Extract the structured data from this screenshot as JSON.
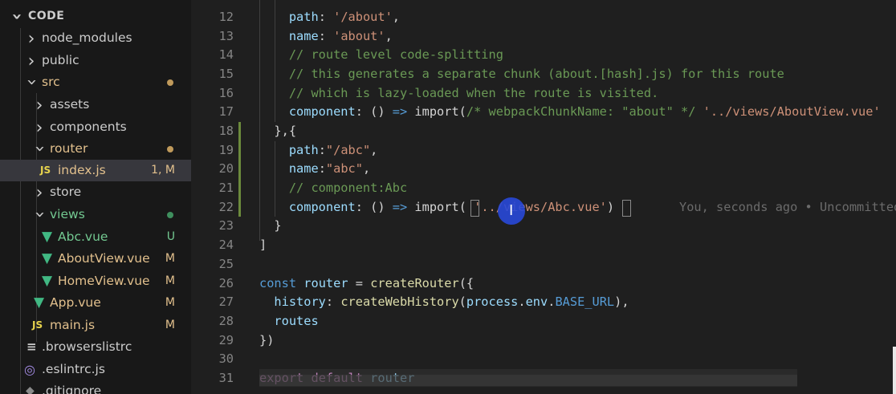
{
  "explorer": {
    "root_label": "CODE",
    "items": [
      {
        "label": "node_modules"
      },
      {
        "label": "public"
      },
      {
        "label": "src"
      },
      {
        "label": "assets"
      },
      {
        "label": "components"
      },
      {
        "label": "router"
      },
      {
        "label": "index.js",
        "icon": "JS",
        "badge": "1, M"
      },
      {
        "label": "store"
      },
      {
        "label": "views"
      },
      {
        "label": "Abc.vue",
        "badge": "U"
      },
      {
        "label": "AboutView.vue",
        "badge": "M"
      },
      {
        "label": "HomeView.vue",
        "badge": "M"
      },
      {
        "label": "App.vue",
        "badge": "M"
      },
      {
        "label": "main.js",
        "icon": "JS",
        "badge": "M"
      },
      {
        "label": ".browserslistrc"
      },
      {
        "label": ".eslintrc.js"
      },
      {
        "label": ".gitignore"
      }
    ]
  },
  "editor": {
    "line_numbers": [
      "12",
      "13",
      "14",
      "15",
      "16",
      "17",
      "18",
      "19",
      "20",
      "21",
      "22",
      "23",
      "24",
      "25",
      "26",
      "27",
      "28",
      "29",
      "30",
      "31"
    ],
    "lines": {
      "l12_a": "    path",
      "l12_b": ": ",
      "l12_c": "'/about'",
      "l12_d": ",",
      "l13_a": "    name",
      "l13_b": ": ",
      "l13_c": "'about'",
      "l13_d": ",",
      "l14": "    // route level code-splitting",
      "l15": "    // this generates a separate chunk (about.[hash].js) for this route",
      "l16": "    // which is lazy-loaded when the route is visited.",
      "l17_a": "    component",
      "l17_b": ": () ",
      "l17_c": "=>",
      "l17_d": " import(",
      "l17_e": "/* webpackChunkName: \"about\" */",
      "l17_f": " ",
      "l17_g": "'../views/AboutView.vue'",
      "l18": "  },{",
      "l19_a": "    path",
      "l19_b": ":",
      "l19_c": "\"/abc\"",
      "l19_d": ",",
      "l20_a": "    name",
      "l20_b": ":",
      "l20_c": "\"abc\"",
      "l20_d": ",",
      "l21": "    // component:Abc",
      "l22_a": "    component",
      "l22_b": ": () ",
      "l22_c": "=>",
      "l22_d": " import",
      "l22_e": "(",
      "l22_f": " ",
      "l22_g": "'../views/Abc.vue'",
      "l22_h": ")",
      "l22_blame": "You, seconds ago • Uncommitted",
      "l23": "  }",
      "l24": "]",
      "l25": "",
      "l26_a": "const",
      "l26_b": " ",
      "l26_c": "router",
      "l26_d": " = ",
      "l26_e": "createRouter",
      "l26_f": "({",
      "l27_a": "  history",
      "l27_b": ": ",
      "l27_c": "createWebHistory",
      "l27_d": "(",
      "l27_e": "process",
      "l27_f": ".",
      "l27_g": "env",
      "l27_h": ".",
      "l27_i": "BASE_URL",
      "l27_j": "),",
      "l28": "  routes",
      "l29": "})",
      "l30": "",
      "l31_a": "export",
      "l31_b": " ",
      "l31_c": "default",
      "l31_d": " ",
      "l31_e": "router"
    }
  },
  "colors": {
    "modified": "#e2c08d",
    "untracked": "#73c991",
    "vue_icon": "#41b883",
    "js_icon": "#e8d44d"
  }
}
